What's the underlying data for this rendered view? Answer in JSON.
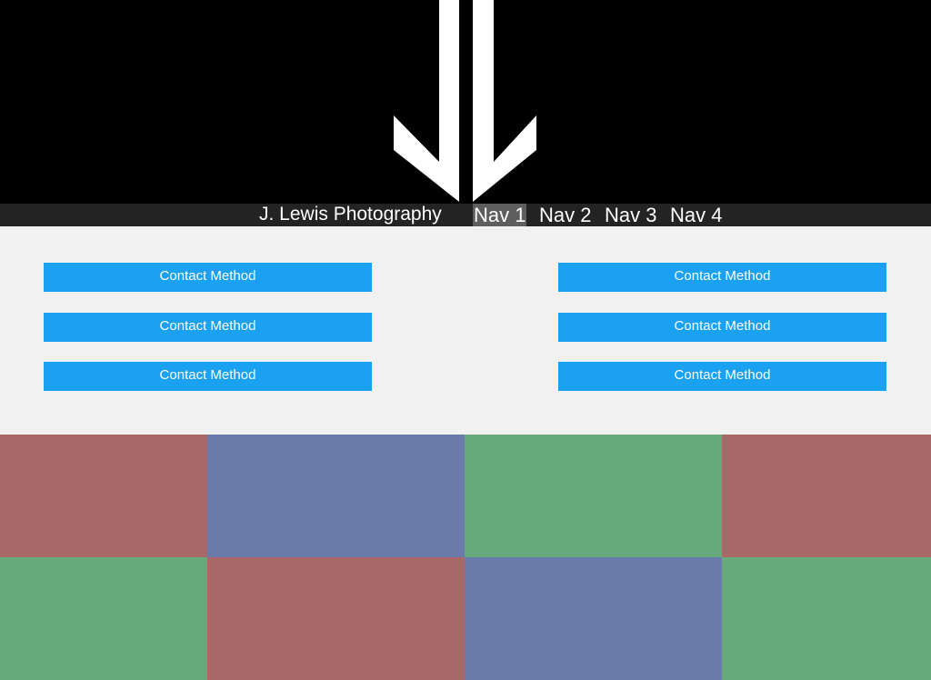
{
  "header": {
    "brand": "J. Lewis Photography",
    "nav": [
      {
        "label": "Nav 1",
        "active": true
      },
      {
        "label": "Nav 2",
        "active": false
      },
      {
        "label": "Nav 3",
        "active": false
      },
      {
        "label": "Nav 4",
        "active": false
      }
    ]
  },
  "hero": {
    "icon": "double-down-arrow-icon",
    "color": "#ffffff"
  },
  "contact": {
    "left": [
      {
        "label": "Contact Method"
      },
      {
        "label": "Contact Method"
      },
      {
        "label": "Contact Method"
      }
    ],
    "right": [
      {
        "label": "Contact Method"
      },
      {
        "label": "Contact Method"
      },
      {
        "label": "Contact Method"
      }
    ],
    "button_color": "#1ba1f2"
  },
  "gallery": {
    "colors": {
      "red": "#a86868",
      "blue": "#6a7aaa",
      "green": "#67a97b"
    },
    "rows": [
      [
        "red",
        "blue",
        "green",
        "red"
      ],
      [
        "green",
        "red",
        "blue",
        "green"
      ]
    ]
  }
}
